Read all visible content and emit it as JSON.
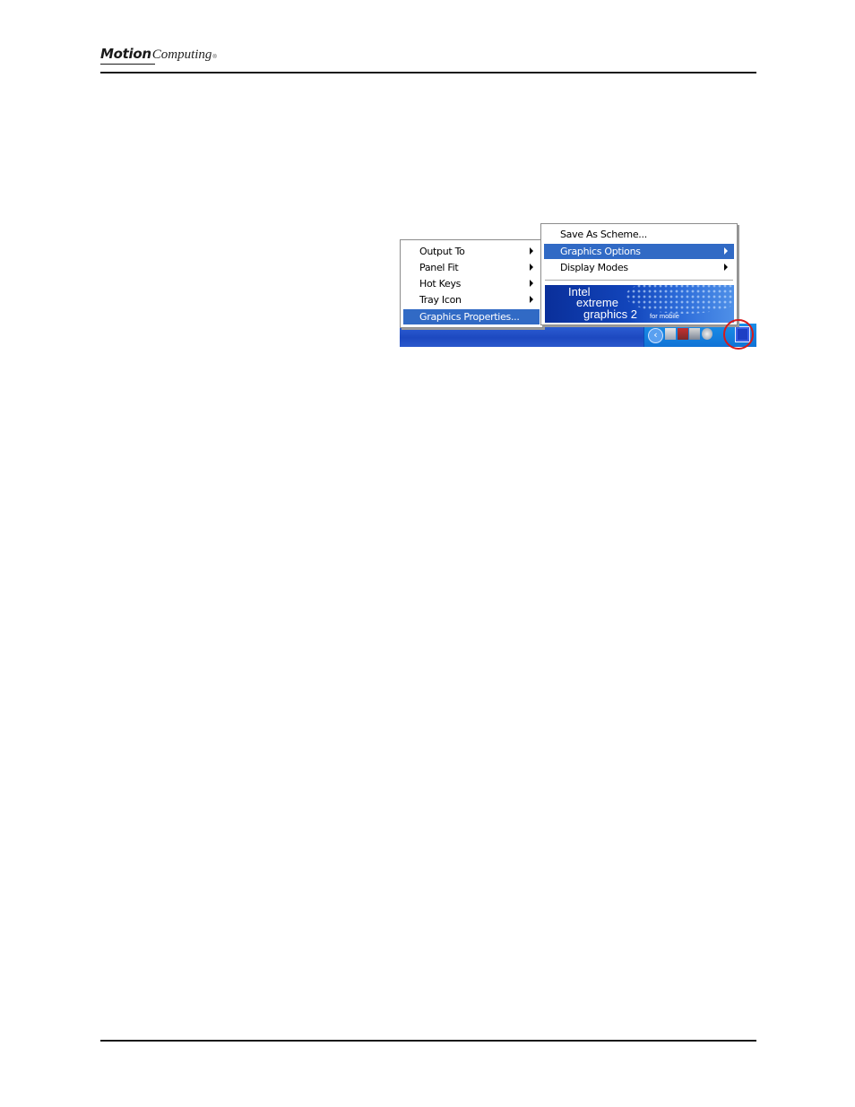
{
  "header": {
    "logo_word1": "Motion",
    "logo_word2": "Computing",
    "logo_reg": "®"
  },
  "screenshot": {
    "left_menu": {
      "items": [
        {
          "label": "Output To",
          "submenu": true
        },
        {
          "label": "Panel Fit",
          "submenu": true
        },
        {
          "label": "Hot Keys",
          "submenu": true
        },
        {
          "label": "Tray Icon",
          "submenu": true
        },
        {
          "label": "Graphics Properties...",
          "submenu": false,
          "selected": true
        }
      ]
    },
    "right_menu": {
      "items": [
        {
          "label": "Save As Scheme...",
          "submenu": false
        },
        {
          "label": "Graphics Options",
          "submenu": true,
          "selected": true
        },
        {
          "label": "Display Modes",
          "submenu": true
        }
      ],
      "banner": {
        "brand": "Intel",
        "line2": "extreme",
        "line3": "graphics 2",
        "suffix": "for mobile"
      }
    },
    "tray": {
      "chevron": "‹",
      "icons": [
        "network-icon",
        "security-icon",
        "device-icon",
        "volume-icon",
        "intel-graphics-icon"
      ]
    },
    "colors": {
      "menu_selection": "#316ac5",
      "taskbar": "#245edb",
      "tray": "#1073d6",
      "highlight_ring": "#d71a1a"
    }
  }
}
